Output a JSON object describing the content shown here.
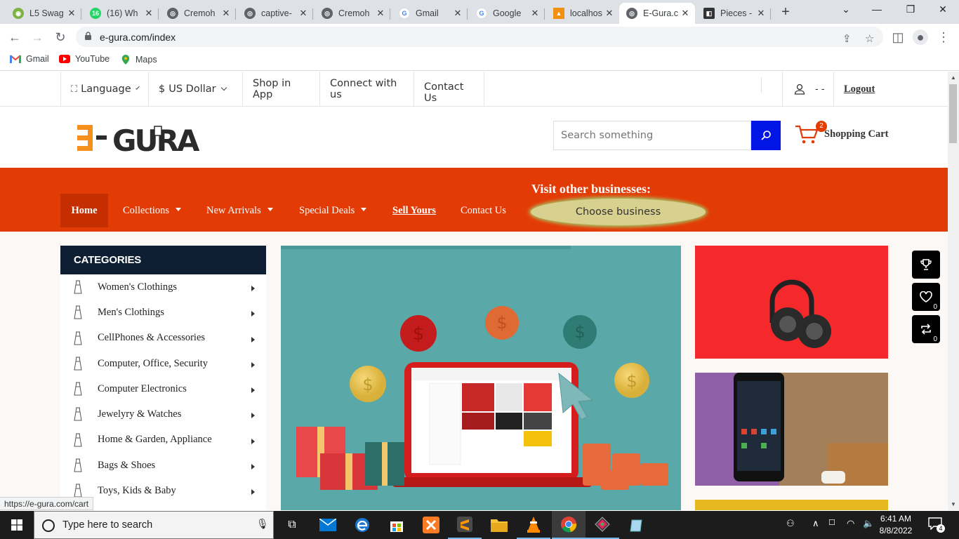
{
  "browser": {
    "tabs": [
      {
        "title": "L5 Swag",
        "favicon": "#4caf50"
      },
      {
        "title": "(16) Wh",
        "favicon": "#25d366"
      },
      {
        "title": "Cremoh",
        "favicon": "#5f6368"
      },
      {
        "title": "captive-",
        "favicon": "#5f6368"
      },
      {
        "title": "Cremoh",
        "favicon": "#5f6368"
      },
      {
        "title": "Gmail",
        "favicon": "#4285f4"
      },
      {
        "title": "Google",
        "favicon": "#4285f4"
      },
      {
        "title": "localhos",
        "favicon": "#f29111"
      },
      {
        "title": "E-Gura.c",
        "favicon": "#5f6368"
      },
      {
        "title": "Pieces -",
        "favicon": "#333333"
      }
    ],
    "active_tab_index": 8,
    "url": "e-gura.com/index",
    "bookmarks": [
      "Gmail",
      "YouTube",
      "Maps"
    ],
    "status_url": "https://e-gura.com/cart"
  },
  "topbar": {
    "language": "Language",
    "currency_symbol": "$",
    "currency": "US Dollar",
    "shop_app": "Shop in App",
    "connect": "Connect with us",
    "contact": "Contact Us",
    "user_name": "- -",
    "logout": "Logout"
  },
  "header": {
    "logo_text": "E-GURA",
    "search_placeholder": "Search something",
    "cart_label": "Shopping Cart",
    "cart_count": "2"
  },
  "nav": {
    "items": [
      "Home",
      "Collections",
      "New Arrivals",
      "Special Deals",
      "Sell Yours",
      "Contact Us"
    ],
    "visit_label": "Visit other businesses:",
    "choose_business": "Choose business"
  },
  "categories": {
    "title": "CATEGORIES",
    "items": [
      "Women's Clothings",
      "Men's Clothings",
      "CellPhones & Accessories",
      "Computer, Office, Security",
      "Computer Electronics",
      "Jewelyry & Watches",
      "Home & Garden, Appliance",
      "Bags & Shoes",
      "Toys, Kids & Baby"
    ]
  },
  "floating": {
    "wishlist_count": "0",
    "compare_count": "0"
  },
  "taskbar": {
    "search_placeholder": "Type here to search",
    "time": "6:41 AM",
    "date": "8/8/2022",
    "notifications": "4"
  },
  "colors": {
    "brand_orange": "#e33b05",
    "nav_active": "#c42e00",
    "category_header": "#0e1f33",
    "search_button": "#0015e6"
  }
}
